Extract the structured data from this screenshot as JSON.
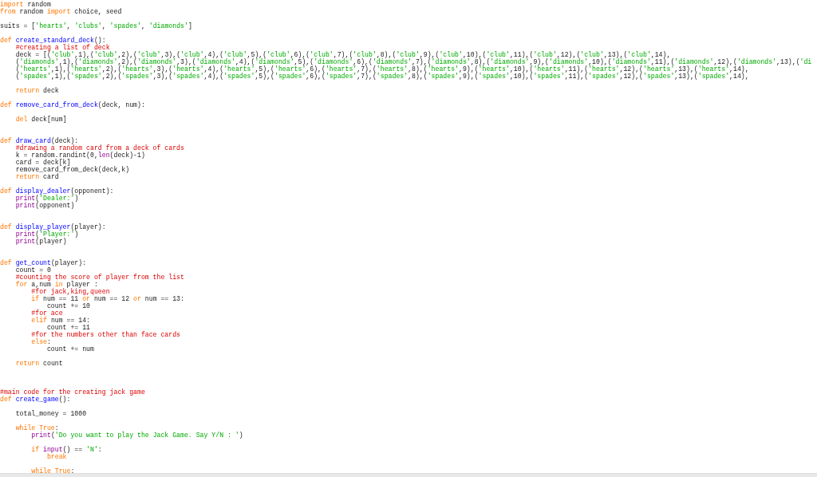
{
  "editor": {
    "lines": [
      {
        "kind": "code",
        "tokens": [
          {
            "kind": "k",
            "text": "import"
          },
          {
            "kind": "p",
            "text": " random"
          }
        ]
      },
      {
        "kind": "code",
        "tokens": [
          {
            "kind": "k",
            "text": "from"
          },
          {
            "kind": "p",
            "text": " random "
          },
          {
            "kind": "k",
            "text": "import"
          },
          {
            "kind": "p",
            "text": " choice, seed"
          }
        ]
      },
      {
        "kind": "blank"
      },
      {
        "kind": "code",
        "tokens": [
          {
            "kind": "p",
            "text": "suits = ["
          },
          {
            "kind": "s",
            "text": "'hearts'"
          },
          {
            "kind": "p",
            "text": ", "
          },
          {
            "kind": "s",
            "text": "'clubs'"
          },
          {
            "kind": "p",
            "text": ", "
          },
          {
            "kind": "s",
            "text": "'spades'"
          },
          {
            "kind": "p",
            "text": ", "
          },
          {
            "kind": "s",
            "text": "'diamonds'"
          },
          {
            "kind": "p",
            "text": "]"
          }
        ]
      },
      {
        "kind": "blank"
      },
      {
        "kind": "code",
        "tokens": [
          {
            "kind": "k",
            "text": "def "
          },
          {
            "kind": "d",
            "text": "create_standard_deck"
          },
          {
            "kind": "p",
            "text": "():"
          }
        ]
      },
      {
        "kind": "code",
        "tokens": [
          {
            "kind": "c",
            "text": "    #creating a list of deck"
          }
        ]
      },
      {
        "kind": "code",
        "tokens": [
          {
            "kind": "p",
            "text": "    deck = [("
          },
          {
            "kind": "s",
            "text": "'club'"
          },
          {
            "kind": "p",
            "text": ",1),("
          },
          {
            "kind": "s",
            "text": "'club'"
          },
          {
            "kind": "p",
            "text": ",2),("
          },
          {
            "kind": "s",
            "text": "'club'"
          },
          {
            "kind": "p",
            "text": ",3),("
          },
          {
            "kind": "s",
            "text": "'club'"
          },
          {
            "kind": "p",
            "text": ",4),("
          },
          {
            "kind": "s",
            "text": "'club'"
          },
          {
            "kind": "p",
            "text": ",5),("
          },
          {
            "kind": "s",
            "text": "'club'"
          },
          {
            "kind": "p",
            "text": ",6),("
          },
          {
            "kind": "s",
            "text": "'club'"
          },
          {
            "kind": "p",
            "text": ",7),("
          },
          {
            "kind": "s",
            "text": "'club'"
          },
          {
            "kind": "p",
            "text": ",8),("
          },
          {
            "kind": "s",
            "text": "'club'"
          },
          {
            "kind": "p",
            "text": ",9),("
          },
          {
            "kind": "s",
            "text": "'club'"
          },
          {
            "kind": "p",
            "text": ",10),("
          },
          {
            "kind": "s",
            "text": "'club'"
          },
          {
            "kind": "p",
            "text": ",11),("
          },
          {
            "kind": "s",
            "text": "'club'"
          },
          {
            "kind": "p",
            "text": ",12),("
          },
          {
            "kind": "s",
            "text": "'club'"
          },
          {
            "kind": "p",
            "text": ",13),("
          },
          {
            "kind": "s",
            "text": "'club'"
          },
          {
            "kind": "p",
            "text": ",14),"
          }
        ]
      },
      {
        "kind": "code",
        "tokens": [
          {
            "kind": "p",
            "text": "    ("
          },
          {
            "kind": "s",
            "text": "'diamonds'"
          },
          {
            "kind": "p",
            "text": ",1),("
          },
          {
            "kind": "s",
            "text": "'diamonds'"
          },
          {
            "kind": "p",
            "text": ",2),("
          },
          {
            "kind": "s",
            "text": "'diamonds'"
          },
          {
            "kind": "p",
            "text": ",3),("
          },
          {
            "kind": "s",
            "text": "'diamonds'"
          },
          {
            "kind": "p",
            "text": ",4),("
          },
          {
            "kind": "s",
            "text": "'diamonds'"
          },
          {
            "kind": "p",
            "text": ",5),("
          },
          {
            "kind": "s",
            "text": "'diamonds'"
          },
          {
            "kind": "p",
            "text": ",6),("
          },
          {
            "kind": "s",
            "text": "'diamonds'"
          },
          {
            "kind": "p",
            "text": ",7),("
          },
          {
            "kind": "s",
            "text": "'diamonds'"
          },
          {
            "kind": "p",
            "text": ",8),("
          },
          {
            "kind": "s",
            "text": "'diamonds'"
          },
          {
            "kind": "p",
            "text": ",9),("
          },
          {
            "kind": "s",
            "text": "'diamonds'"
          },
          {
            "kind": "p",
            "text": ",10),("
          },
          {
            "kind": "s",
            "text": "'diamonds'"
          },
          {
            "kind": "p",
            "text": ",11),("
          },
          {
            "kind": "s",
            "text": "'diamonds'"
          },
          {
            "kind": "p",
            "text": ",12),("
          },
          {
            "kind": "s",
            "text": "'diamonds'"
          },
          {
            "kind": "p",
            "text": ",13),("
          },
          {
            "kind": "s",
            "text": "'di"
          }
        ]
      },
      {
        "kind": "code",
        "tokens": [
          {
            "kind": "p",
            "text": "    ("
          },
          {
            "kind": "s",
            "text": "'hearts'"
          },
          {
            "kind": "p",
            "text": ",1),("
          },
          {
            "kind": "s",
            "text": "'hearts'"
          },
          {
            "kind": "p",
            "text": ",2),("
          },
          {
            "kind": "s",
            "text": "'hearts'"
          },
          {
            "kind": "p",
            "text": ",3),("
          },
          {
            "kind": "s",
            "text": "'hearts'"
          },
          {
            "kind": "p",
            "text": ",4),("
          },
          {
            "kind": "s",
            "text": "'hearts'"
          },
          {
            "kind": "p",
            "text": ",5),("
          },
          {
            "kind": "s",
            "text": "'hearts'"
          },
          {
            "kind": "p",
            "text": ",6),("
          },
          {
            "kind": "s",
            "text": "'hearts'"
          },
          {
            "kind": "p",
            "text": ",7),("
          },
          {
            "kind": "s",
            "text": "'hearts'"
          },
          {
            "kind": "p",
            "text": ",8),("
          },
          {
            "kind": "s",
            "text": "'hearts'"
          },
          {
            "kind": "p",
            "text": ",9),("
          },
          {
            "kind": "s",
            "text": "'hearts'"
          },
          {
            "kind": "p",
            "text": ",10),("
          },
          {
            "kind": "s",
            "text": "'hearts'"
          },
          {
            "kind": "p",
            "text": ",11),("
          },
          {
            "kind": "s",
            "text": "'hearts'"
          },
          {
            "kind": "p",
            "text": ",12),("
          },
          {
            "kind": "s",
            "text": "'hearts'"
          },
          {
            "kind": "p",
            "text": ",13),("
          },
          {
            "kind": "s",
            "text": "'hearts'"
          },
          {
            "kind": "p",
            "text": ",14),"
          }
        ]
      },
      {
        "kind": "code",
        "tokens": [
          {
            "kind": "p",
            "text": "    ("
          },
          {
            "kind": "s",
            "text": "'spades'"
          },
          {
            "kind": "p",
            "text": ",1),("
          },
          {
            "kind": "s",
            "text": "'spades'"
          },
          {
            "kind": "p",
            "text": ",2),("
          },
          {
            "kind": "s",
            "text": "'spades'"
          },
          {
            "kind": "p",
            "text": ",3),("
          },
          {
            "kind": "s",
            "text": "'spades'"
          },
          {
            "kind": "p",
            "text": ",4),("
          },
          {
            "kind": "s",
            "text": "'spades'"
          },
          {
            "kind": "p",
            "text": ",5),("
          },
          {
            "kind": "s",
            "text": "'spades'"
          },
          {
            "kind": "p",
            "text": ",6),("
          },
          {
            "kind": "s",
            "text": "'spades'"
          },
          {
            "kind": "p",
            "text": ",7),("
          },
          {
            "kind": "s",
            "text": "'spades'"
          },
          {
            "kind": "p",
            "text": ",8),("
          },
          {
            "kind": "s",
            "text": "'spades'"
          },
          {
            "kind": "p",
            "text": ",9),("
          },
          {
            "kind": "s",
            "text": "'spades'"
          },
          {
            "kind": "p",
            "text": ",10),("
          },
          {
            "kind": "s",
            "text": "'spades'"
          },
          {
            "kind": "p",
            "text": ",11),("
          },
          {
            "kind": "s",
            "text": "'spades'"
          },
          {
            "kind": "p",
            "text": ",12),("
          },
          {
            "kind": "s",
            "text": "'spades'"
          },
          {
            "kind": "p",
            "text": ",13),("
          },
          {
            "kind": "s",
            "text": "'spades'"
          },
          {
            "kind": "p",
            "text": ",14),"
          }
        ]
      },
      {
        "kind": "blank"
      },
      {
        "kind": "code",
        "tokens": [
          {
            "kind": "k",
            "text": "    return"
          },
          {
            "kind": "p",
            "text": " deck"
          }
        ]
      },
      {
        "kind": "blank"
      },
      {
        "kind": "code",
        "tokens": [
          {
            "kind": "k",
            "text": "def "
          },
          {
            "kind": "d",
            "text": "remove_card_from_deck"
          },
          {
            "kind": "p",
            "text": "(deck, num):"
          }
        ]
      },
      {
        "kind": "blank"
      },
      {
        "kind": "code",
        "tokens": [
          {
            "kind": "k",
            "text": "    del"
          },
          {
            "kind": "p",
            "text": " deck[num]"
          }
        ]
      },
      {
        "kind": "blank"
      },
      {
        "kind": "blank"
      },
      {
        "kind": "code",
        "tokens": [
          {
            "kind": "k",
            "text": "def "
          },
          {
            "kind": "d",
            "text": "draw_card"
          },
          {
            "kind": "p",
            "text": "(deck):"
          }
        ]
      },
      {
        "kind": "code",
        "tokens": [
          {
            "kind": "c",
            "text": "    #drawing a random card from a deck of cards"
          }
        ]
      },
      {
        "kind": "code",
        "tokens": [
          {
            "kind": "p",
            "text": "    k = random.randint(0,"
          },
          {
            "kind": "b",
            "text": "len"
          },
          {
            "kind": "p",
            "text": "(deck)-1)"
          }
        ]
      },
      {
        "kind": "code",
        "tokens": [
          {
            "kind": "p",
            "text": "    card = deck[k]"
          }
        ]
      },
      {
        "kind": "code",
        "tokens": [
          {
            "kind": "p",
            "text": "    remove_card_from_deck(deck,k)"
          }
        ]
      },
      {
        "kind": "code",
        "tokens": [
          {
            "kind": "k",
            "text": "    return"
          },
          {
            "kind": "p",
            "text": " card"
          }
        ]
      },
      {
        "kind": "blank"
      },
      {
        "kind": "code",
        "tokens": [
          {
            "kind": "k",
            "text": "def "
          },
          {
            "kind": "d",
            "text": "display_dealer"
          },
          {
            "kind": "p",
            "text": "(opponent):"
          }
        ]
      },
      {
        "kind": "code",
        "tokens": [
          {
            "kind": "b",
            "text": "    print"
          },
          {
            "kind": "p",
            "text": "("
          },
          {
            "kind": "s",
            "text": "'Dealer:'"
          },
          {
            "kind": "p",
            "text": ")"
          }
        ]
      },
      {
        "kind": "code",
        "tokens": [
          {
            "kind": "b",
            "text": "    print"
          },
          {
            "kind": "p",
            "text": "(opponent)"
          }
        ]
      },
      {
        "kind": "blank"
      },
      {
        "kind": "blank"
      },
      {
        "kind": "code",
        "tokens": [
          {
            "kind": "k",
            "text": "def "
          },
          {
            "kind": "d",
            "text": "display_player"
          },
          {
            "kind": "p",
            "text": "(player):"
          }
        ]
      },
      {
        "kind": "code",
        "tokens": [
          {
            "kind": "b",
            "text": "    print"
          },
          {
            "kind": "p",
            "text": "("
          },
          {
            "kind": "s",
            "text": "'Player:'"
          },
          {
            "kind": "p",
            "text": ")"
          }
        ]
      },
      {
        "kind": "code",
        "tokens": [
          {
            "kind": "b",
            "text": "    print"
          },
          {
            "kind": "p",
            "text": "(player)"
          }
        ]
      },
      {
        "kind": "blank"
      },
      {
        "kind": "blank"
      },
      {
        "kind": "code",
        "tokens": [
          {
            "kind": "k",
            "text": "def "
          },
          {
            "kind": "d",
            "text": "get_count"
          },
          {
            "kind": "p",
            "text": "(player):"
          }
        ]
      },
      {
        "kind": "code",
        "tokens": [
          {
            "kind": "p",
            "text": "    count = 0"
          }
        ]
      },
      {
        "kind": "code",
        "tokens": [
          {
            "kind": "c",
            "text": "    #counting the score of player from the list"
          }
        ]
      },
      {
        "kind": "code",
        "tokens": [
          {
            "kind": "k",
            "text": "    for"
          },
          {
            "kind": "p",
            "text": " a,num "
          },
          {
            "kind": "k",
            "text": "in"
          },
          {
            "kind": "p",
            "text": " player :"
          }
        ]
      },
      {
        "kind": "code",
        "tokens": [
          {
            "kind": "c",
            "text": "        #for jack,king,queen"
          }
        ]
      },
      {
        "kind": "code",
        "tokens": [
          {
            "kind": "k",
            "text": "        if"
          },
          {
            "kind": "p",
            "text": " num == 11 "
          },
          {
            "kind": "k",
            "text": "or"
          },
          {
            "kind": "p",
            "text": " num == 12 "
          },
          {
            "kind": "k",
            "text": "or"
          },
          {
            "kind": "p",
            "text": " num == 13:"
          }
        ]
      },
      {
        "kind": "code",
        "tokens": [
          {
            "kind": "p",
            "text": "            count += 10"
          }
        ]
      },
      {
        "kind": "code",
        "tokens": [
          {
            "kind": "c",
            "text": "        #for ace"
          }
        ]
      },
      {
        "kind": "code",
        "tokens": [
          {
            "kind": "k",
            "text": "        elif"
          },
          {
            "kind": "p",
            "text": " num == 14:"
          }
        ]
      },
      {
        "kind": "code",
        "tokens": [
          {
            "kind": "p",
            "text": "            count += 11"
          }
        ]
      },
      {
        "kind": "code",
        "tokens": [
          {
            "kind": "c",
            "text": "        #for the numbers other than face cards"
          }
        ]
      },
      {
        "kind": "code",
        "tokens": [
          {
            "kind": "k",
            "text": "        else"
          },
          {
            "kind": "p",
            "text": ":"
          }
        ]
      },
      {
        "kind": "code",
        "tokens": [
          {
            "kind": "p",
            "text": "            count += num"
          }
        ]
      },
      {
        "kind": "blank"
      },
      {
        "kind": "code",
        "tokens": [
          {
            "kind": "k",
            "text": "    return"
          },
          {
            "kind": "p",
            "text": " count"
          }
        ]
      },
      {
        "kind": "blank"
      },
      {
        "kind": "blank"
      },
      {
        "kind": "blank"
      },
      {
        "kind": "code",
        "tokens": [
          {
            "kind": "c",
            "text": "#main code for the creating jack game"
          }
        ]
      },
      {
        "kind": "code",
        "tokens": [
          {
            "kind": "k",
            "text": "def "
          },
          {
            "kind": "d",
            "text": "create_game"
          },
          {
            "kind": "p",
            "text": "():"
          }
        ]
      },
      {
        "kind": "blank"
      },
      {
        "kind": "code",
        "tokens": [
          {
            "kind": "p",
            "text": "    total_money = 1000"
          }
        ]
      },
      {
        "kind": "blank"
      },
      {
        "kind": "code",
        "tokens": [
          {
            "kind": "k",
            "text": "    while True"
          },
          {
            "kind": "p",
            "text": ":"
          }
        ]
      },
      {
        "kind": "code",
        "tokens": [
          {
            "kind": "b",
            "text": "        print"
          },
          {
            "kind": "p",
            "text": "("
          },
          {
            "kind": "s",
            "text": "'Do you want to play the Jack Game. Say Y/N : '"
          },
          {
            "kind": "p",
            "text": ")"
          }
        ]
      },
      {
        "kind": "blank"
      },
      {
        "kind": "code",
        "tokens": [
          {
            "kind": "k",
            "text": "        if "
          },
          {
            "kind": "b",
            "text": "input"
          },
          {
            "kind": "p",
            "text": "() == "
          },
          {
            "kind": "s",
            "text": "'N'"
          },
          {
            "kind": "p",
            "text": ":"
          }
        ]
      },
      {
        "kind": "code",
        "tokens": [
          {
            "kind": "k",
            "text": "            break"
          }
        ]
      },
      {
        "kind": "blank"
      },
      {
        "kind": "code",
        "tokens": [
          {
            "kind": "k",
            "text": "        while True"
          },
          {
            "kind": "p",
            "text": ":"
          }
        ]
      }
    ]
  }
}
